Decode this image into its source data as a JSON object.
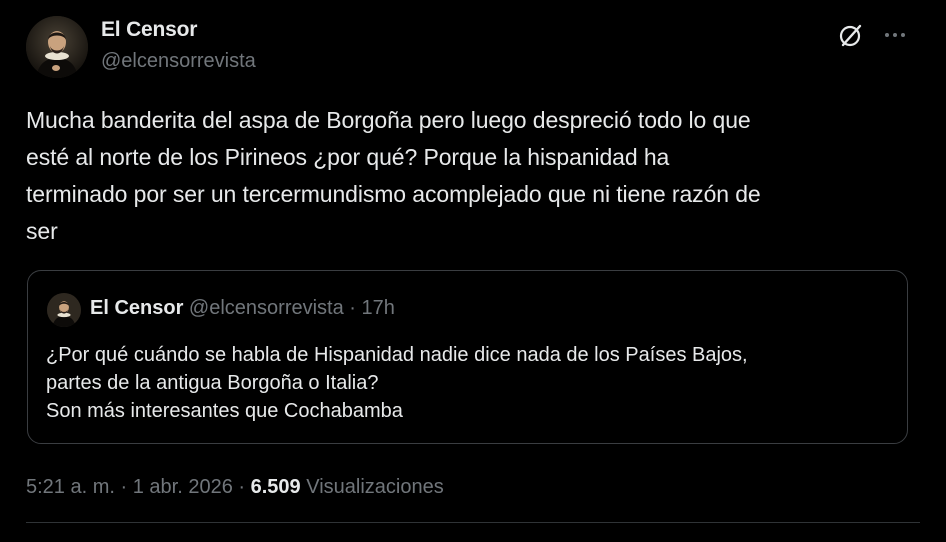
{
  "author": {
    "name": "El Censor",
    "handle": "@elcensorrevista"
  },
  "tweet": {
    "text": "Mucha banderita del aspa de Borgoña pero luego despreció todo lo que\nesté al norte de los Pirineos ¿por qué? Porque la hispanidad ha\nterminado por ser un tercermundismo acomplejado que ni tiene razón de\nser"
  },
  "quoted": {
    "name": "El Censor",
    "handle": "@elcensorrevista",
    "separator": "·",
    "time": "17h",
    "text": "¿Por qué cuándo se habla de Hispanidad nadie dice nada de los Países Bajos,\npartes de la antigua Borgoña o Italia?\nSon más interesantes que Cochabamba"
  },
  "meta": {
    "time": "5:21 a. m.",
    "sep1": "·",
    "date": "1 abr. 2026",
    "sep2": "·",
    "views_count": "6.509",
    "views_label": "Visualizaciones"
  },
  "icons": {
    "grok": "grok-icon",
    "more": "more-icon"
  },
  "colors": {
    "background": "#000000",
    "text": "#e7e9ea",
    "secondary": "#71767b",
    "border": "#3a3d41"
  }
}
